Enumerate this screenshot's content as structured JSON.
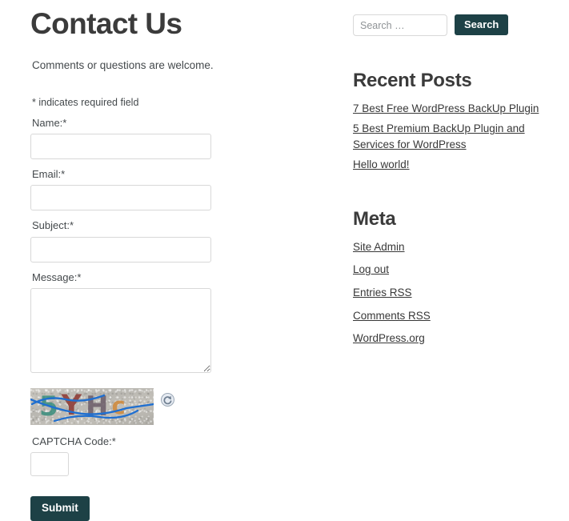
{
  "main": {
    "title": "Contact Us",
    "intro": "Comments or questions are welcome.",
    "required_note": "* indicates required field",
    "fields": [
      {
        "label": "Name:*",
        "value": "",
        "type": "text"
      },
      {
        "label": "Email:*",
        "value": "",
        "type": "text"
      },
      {
        "label": "Subject:*",
        "value": "",
        "type": "text"
      },
      {
        "label": "Message:*",
        "value": "",
        "type": "textarea"
      }
    ],
    "captcha": {
      "characters": [
        "5",
        "Y",
        "H",
        "c"
      ],
      "code_label": "CAPTCHA Code:*",
      "code_value": "",
      "refresh_icon": "refresh-icon",
      "char_colors": [
        "#3d8f7e",
        "#8e3a34",
        "#6e5f6b",
        "#d08a3c"
      ],
      "squiggle_color": "#1f6fd0"
    },
    "submit_label": "Submit"
  },
  "sidebar": {
    "search": {
      "placeholder": "Search …",
      "value": "",
      "button_label": "Search"
    },
    "widgets": [
      {
        "title": "Recent Posts",
        "links": [
          "7 Best Free WordPress BackUp Plugin",
          "5 Best Premium BackUp Plugin and Services for WordPress",
          "Hello world!"
        ]
      },
      {
        "title": "Meta",
        "links": [
          "Site Admin",
          "Log out",
          "Entries RSS",
          "Comments RSS",
          "WordPress.org"
        ]
      }
    ]
  },
  "theme": {
    "accent": "#1d4146",
    "heading": "#3b3b3b",
    "body_text": "#44494c",
    "border": "#d8d8d8"
  }
}
